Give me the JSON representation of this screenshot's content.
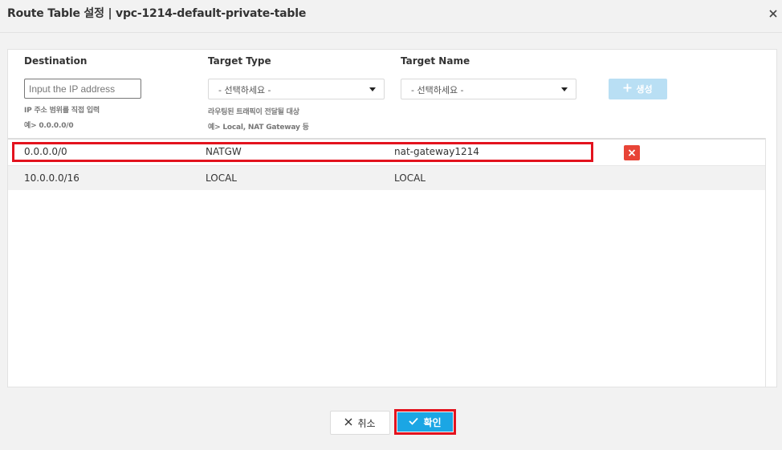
{
  "dialog": {
    "title": "Route Table 설정 | vpc-1214-default-private-table"
  },
  "columns": {
    "destination": "Destination",
    "target_type": "Target Type",
    "target_name": "Target Name"
  },
  "form": {
    "ip_placeholder": "Input the IP address",
    "ip_value": "",
    "ip_help_1": "IP 주소 범위를 직접 입력",
    "ip_help_2": "예> 0.0.0.0/0",
    "target_type_selected": "- 선택하세요 -",
    "target_type_help_1": "라우팅된 트래픽이 전달될 대상",
    "target_type_help_2": "예> Local, NAT Gateway 등",
    "target_name_selected": "- 선택하세요 -",
    "add_label": "생성"
  },
  "routes": [
    {
      "destination": "0.0.0.0/0",
      "target_type": "NATGW",
      "target_name": "nat-gateway1214"
    },
    {
      "destination": "10.0.0.0/16",
      "target_type": "LOCAL",
      "target_name": "LOCAL"
    }
  ],
  "footer": {
    "cancel_label": "취소",
    "confirm_label": "확인"
  },
  "colors": {
    "accent": "#1ba6e4",
    "add_disabled": "#b9dff4",
    "delete": "#e84437",
    "highlight": "#e3131e"
  },
  "icons": {
    "close": "close-icon",
    "plus": "plus-icon",
    "delete": "delete-icon",
    "cancel": "cancel-x-icon",
    "confirm": "check-icon",
    "dropdown": "caret-down-icon"
  }
}
